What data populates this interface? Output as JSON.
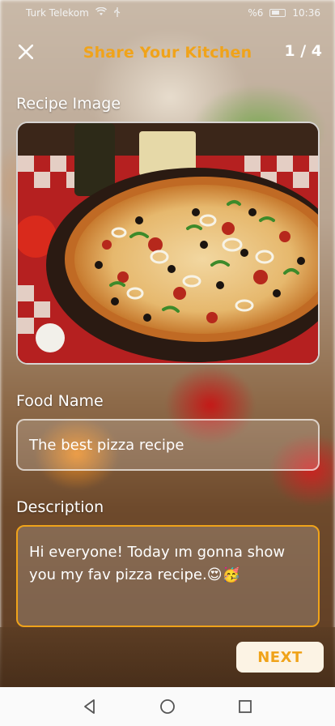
{
  "status_bar": {
    "carrier": "Turk Telekom",
    "battery": "%6",
    "time": "10:36"
  },
  "header": {
    "title": "Share Your Kitchen",
    "step": "1 / 4",
    "close_icon": "close-icon"
  },
  "recipe_image": {
    "label": "Recipe Image",
    "image": "pizza-photo"
  },
  "food_name": {
    "label": "Food Name",
    "value": "The best pizza recipe"
  },
  "description": {
    "label": "Description",
    "value": "Hi everyone! Today ım gonna show you my fav pizza recipe.😍🥳"
  },
  "footer": {
    "next_label": "NEXT"
  },
  "colors": {
    "accent": "#f0a31a",
    "button_bg": "#fcf3e4"
  },
  "nav": {
    "back_icon": "back-triangle-icon",
    "home_icon": "home-circle-icon",
    "recents_icon": "recents-square-icon"
  }
}
